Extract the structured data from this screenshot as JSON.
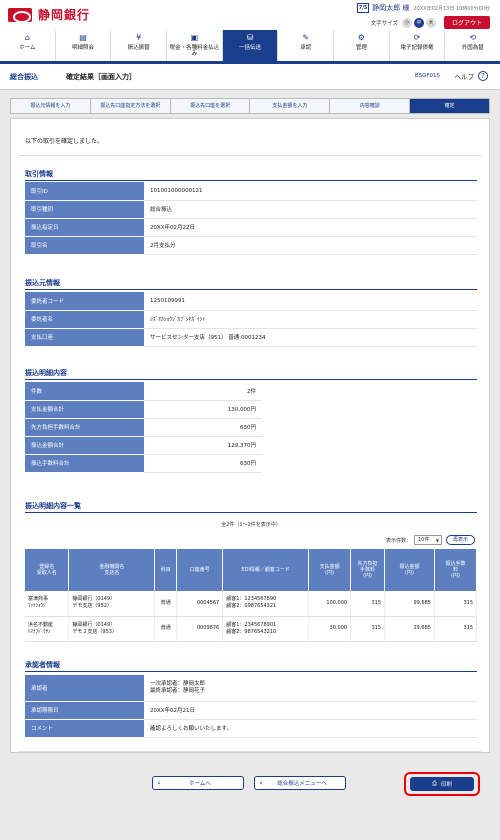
{
  "header": {
    "logo_text": "静岡銀行",
    "user_badge": "7/5",
    "user_name": "静岡太郎 様",
    "login_time": "20XX年02月13日 10時00分00秒",
    "font_size_label": "文字サイズ",
    "font_sizes": [
      "小",
      "中",
      "大"
    ],
    "logout_label": "ログアウト"
  },
  "nav": {
    "items": [
      {
        "label": "ホーム",
        "icon": "home-icon",
        "glyph": "⌂"
      },
      {
        "label": "明細照会",
        "icon": "document-icon",
        "glyph": "▤"
      },
      {
        "label": "振込振替",
        "icon": "transfer-icon",
        "glyph": "¥"
      },
      {
        "label": "税金・各種料金払込み",
        "icon": "tax-payment-icon",
        "glyph": "▣"
      },
      {
        "label": "一括伝送",
        "icon": "batch-transfer-icon",
        "glyph": "⛁"
      },
      {
        "label": "承認",
        "icon": "approval-icon",
        "glyph": "✎"
      },
      {
        "label": "管理",
        "icon": "settings-icon",
        "glyph": "⚙"
      },
      {
        "label": "電子記録債権",
        "icon": "e-bond-icon",
        "glyph": "⟳"
      },
      {
        "label": "外国為替",
        "icon": "forex-icon",
        "glyph": "⟲"
      }
    ],
    "active_index": 4
  },
  "titlebar": {
    "category": "総合振込",
    "title": "確定結果［画面入力］",
    "screen_code": "BSGF015",
    "help_label": "ヘルプ"
  },
  "steps": [
    "振込元情報を入力",
    "振込先口座指定方法を選択",
    "振込先口座を選択",
    "支払金額を入力",
    "内容確認",
    "確定"
  ],
  "intro_text": "以下の取引を確定しました。",
  "transaction_info": {
    "title": "取引情報",
    "rows": [
      {
        "key": "取引ID",
        "value": "101001000000121"
      },
      {
        "key": "取引種別",
        "value": "総合振込"
      },
      {
        "key": "振込指定日",
        "value": "20XX年02月22日"
      },
      {
        "key": "取引名",
        "value": "2月支払分"
      }
    ]
  },
  "source_info": {
    "title": "振込元情報",
    "rows": [
      {
        "key": "委託者コード",
        "value": "1250109991"
      },
      {
        "key": "委託者名",
        "value": "ｼｽﾞｵｶｼｮｳｼﾞｶﾌﾞｼｷｶﾞｲｼｬ"
      },
      {
        "key": "支払口座",
        "value": "サービスセンター支店（951） 普通 0001234"
      }
    ]
  },
  "summary_info": {
    "title": "振込明細内容",
    "rows": [
      {
        "key": "件数",
        "value": "2件"
      },
      {
        "key": "支払金額合計",
        "value": "130,000円"
      },
      {
        "key": "先方負担手数料合計",
        "value": "630円"
      },
      {
        "key": "振込金額合計",
        "value": "129,370円"
      },
      {
        "key": "振込手数料合計",
        "value": "630円"
      }
    ]
  },
  "detail_list": {
    "title": "振込明細内容一覧",
    "caption": "全2件（1～2件を表示中）",
    "page_size_label": "表示件数：",
    "page_size_value": "10件",
    "redisplay_label": "再表示",
    "headers": [
      "登録名\n受取人名",
      "金融機関名\n支店名",
      "科目",
      "口座番号",
      "EDI情報／顧客コード",
      "支払金額\n(円)",
      "先方負担\n手数料\n(円)",
      "振込金額\n(円)",
      "振込手数\n料\n(円)"
    ],
    "rows": [
      {
        "reg": "富津商事",
        "payee": "ﾌｯﾂｼｮｳｼﾞ",
        "bank": "静岡銀行（0149）",
        "branch": "デモ支店（952）",
        "type": "普通",
        "account": "0004567",
        "edi1": "顧客1：1234567890",
        "edi2": "顧客2：0987654321",
        "pay": "100,000",
        "fee_payee": "315",
        "transfer": "99,685",
        "fee": "315"
      },
      {
        "reg": "浜名不動産",
        "payee": "ﾊﾏﾅﾌﾄﾞｳｻﾝ",
        "bank": "静岡銀行（0149）",
        "branch": "デモ２支店（953）",
        "type": "普通",
        "account": "0009876",
        "edi1": "顧客1：2345678901",
        "edi2": "顧客2：9876543210",
        "pay": "30,000",
        "fee_payee": "315",
        "transfer": "29,685",
        "fee": "315"
      }
    ]
  },
  "approver_info": {
    "title": "承認者情報",
    "approver_key": "承認者",
    "approver_line1": "一次承認者：静岡太郎",
    "approver_line2": "最終承認者：静岡花子",
    "rows": [
      {
        "key": "承認期限日",
        "value": "20XX年02月21日"
      },
      {
        "key": "コメント",
        "value": "確認よろしくお願いいたします。"
      }
    ]
  },
  "footer": {
    "home_label": "ホームへ",
    "menu_label": "総合振込メニューへ",
    "print_label": "印刷"
  },
  "colors": {
    "brand_red": "#c8102e",
    "brand_blue": "#1a3e8c",
    "table_header_blue": "#5d7fbf",
    "highlight_red": "#e00000"
  }
}
